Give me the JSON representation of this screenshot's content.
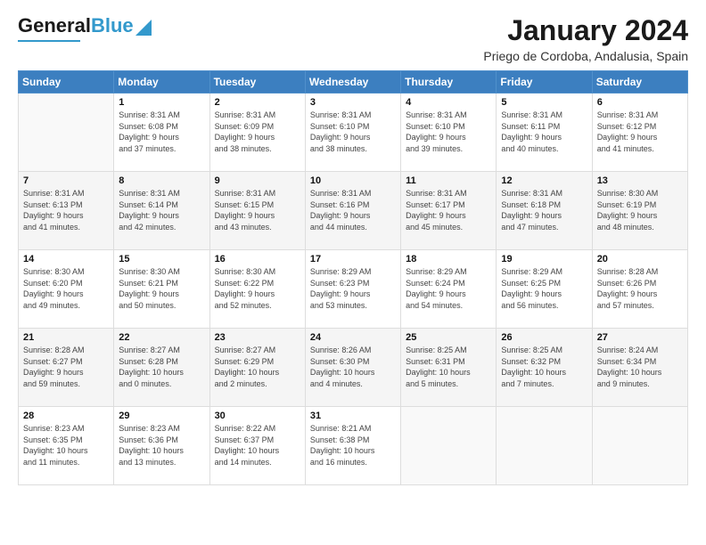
{
  "header": {
    "logo_general": "General",
    "logo_blue": "Blue",
    "month_year": "January 2024",
    "location": "Priego de Cordoba, Andalusia, Spain"
  },
  "days_of_week": [
    "Sunday",
    "Monday",
    "Tuesday",
    "Wednesday",
    "Thursday",
    "Friday",
    "Saturday"
  ],
  "weeks": [
    [
      {
        "num": "",
        "info": ""
      },
      {
        "num": "1",
        "info": "Sunrise: 8:31 AM\nSunset: 6:08 PM\nDaylight: 9 hours\nand 37 minutes."
      },
      {
        "num": "2",
        "info": "Sunrise: 8:31 AM\nSunset: 6:09 PM\nDaylight: 9 hours\nand 38 minutes."
      },
      {
        "num": "3",
        "info": "Sunrise: 8:31 AM\nSunset: 6:10 PM\nDaylight: 9 hours\nand 38 minutes."
      },
      {
        "num": "4",
        "info": "Sunrise: 8:31 AM\nSunset: 6:10 PM\nDaylight: 9 hours\nand 39 minutes."
      },
      {
        "num": "5",
        "info": "Sunrise: 8:31 AM\nSunset: 6:11 PM\nDaylight: 9 hours\nand 40 minutes."
      },
      {
        "num": "6",
        "info": "Sunrise: 8:31 AM\nSunset: 6:12 PM\nDaylight: 9 hours\nand 41 minutes."
      }
    ],
    [
      {
        "num": "7",
        "info": "Sunrise: 8:31 AM\nSunset: 6:13 PM\nDaylight: 9 hours\nand 41 minutes."
      },
      {
        "num": "8",
        "info": "Sunrise: 8:31 AM\nSunset: 6:14 PM\nDaylight: 9 hours\nand 42 minutes."
      },
      {
        "num": "9",
        "info": "Sunrise: 8:31 AM\nSunset: 6:15 PM\nDaylight: 9 hours\nand 43 minutes."
      },
      {
        "num": "10",
        "info": "Sunrise: 8:31 AM\nSunset: 6:16 PM\nDaylight: 9 hours\nand 44 minutes."
      },
      {
        "num": "11",
        "info": "Sunrise: 8:31 AM\nSunset: 6:17 PM\nDaylight: 9 hours\nand 45 minutes."
      },
      {
        "num": "12",
        "info": "Sunrise: 8:31 AM\nSunset: 6:18 PM\nDaylight: 9 hours\nand 47 minutes."
      },
      {
        "num": "13",
        "info": "Sunrise: 8:30 AM\nSunset: 6:19 PM\nDaylight: 9 hours\nand 48 minutes."
      }
    ],
    [
      {
        "num": "14",
        "info": "Sunrise: 8:30 AM\nSunset: 6:20 PM\nDaylight: 9 hours\nand 49 minutes."
      },
      {
        "num": "15",
        "info": "Sunrise: 8:30 AM\nSunset: 6:21 PM\nDaylight: 9 hours\nand 50 minutes."
      },
      {
        "num": "16",
        "info": "Sunrise: 8:30 AM\nSunset: 6:22 PM\nDaylight: 9 hours\nand 52 minutes."
      },
      {
        "num": "17",
        "info": "Sunrise: 8:29 AM\nSunset: 6:23 PM\nDaylight: 9 hours\nand 53 minutes."
      },
      {
        "num": "18",
        "info": "Sunrise: 8:29 AM\nSunset: 6:24 PM\nDaylight: 9 hours\nand 54 minutes."
      },
      {
        "num": "19",
        "info": "Sunrise: 8:29 AM\nSunset: 6:25 PM\nDaylight: 9 hours\nand 56 minutes."
      },
      {
        "num": "20",
        "info": "Sunrise: 8:28 AM\nSunset: 6:26 PM\nDaylight: 9 hours\nand 57 minutes."
      }
    ],
    [
      {
        "num": "21",
        "info": "Sunrise: 8:28 AM\nSunset: 6:27 PM\nDaylight: 9 hours\nand 59 minutes."
      },
      {
        "num": "22",
        "info": "Sunrise: 8:27 AM\nSunset: 6:28 PM\nDaylight: 10 hours\nand 0 minutes."
      },
      {
        "num": "23",
        "info": "Sunrise: 8:27 AM\nSunset: 6:29 PM\nDaylight: 10 hours\nand 2 minutes."
      },
      {
        "num": "24",
        "info": "Sunrise: 8:26 AM\nSunset: 6:30 PM\nDaylight: 10 hours\nand 4 minutes."
      },
      {
        "num": "25",
        "info": "Sunrise: 8:25 AM\nSunset: 6:31 PM\nDaylight: 10 hours\nand 5 minutes."
      },
      {
        "num": "26",
        "info": "Sunrise: 8:25 AM\nSunset: 6:32 PM\nDaylight: 10 hours\nand 7 minutes."
      },
      {
        "num": "27",
        "info": "Sunrise: 8:24 AM\nSunset: 6:34 PM\nDaylight: 10 hours\nand 9 minutes."
      }
    ],
    [
      {
        "num": "28",
        "info": "Sunrise: 8:23 AM\nSunset: 6:35 PM\nDaylight: 10 hours\nand 11 minutes."
      },
      {
        "num": "29",
        "info": "Sunrise: 8:23 AM\nSunset: 6:36 PM\nDaylight: 10 hours\nand 13 minutes."
      },
      {
        "num": "30",
        "info": "Sunrise: 8:22 AM\nSunset: 6:37 PM\nDaylight: 10 hours\nand 14 minutes."
      },
      {
        "num": "31",
        "info": "Sunrise: 8:21 AM\nSunset: 6:38 PM\nDaylight: 10 hours\nand 16 minutes."
      },
      {
        "num": "",
        "info": ""
      },
      {
        "num": "",
        "info": ""
      },
      {
        "num": "",
        "info": ""
      }
    ]
  ]
}
